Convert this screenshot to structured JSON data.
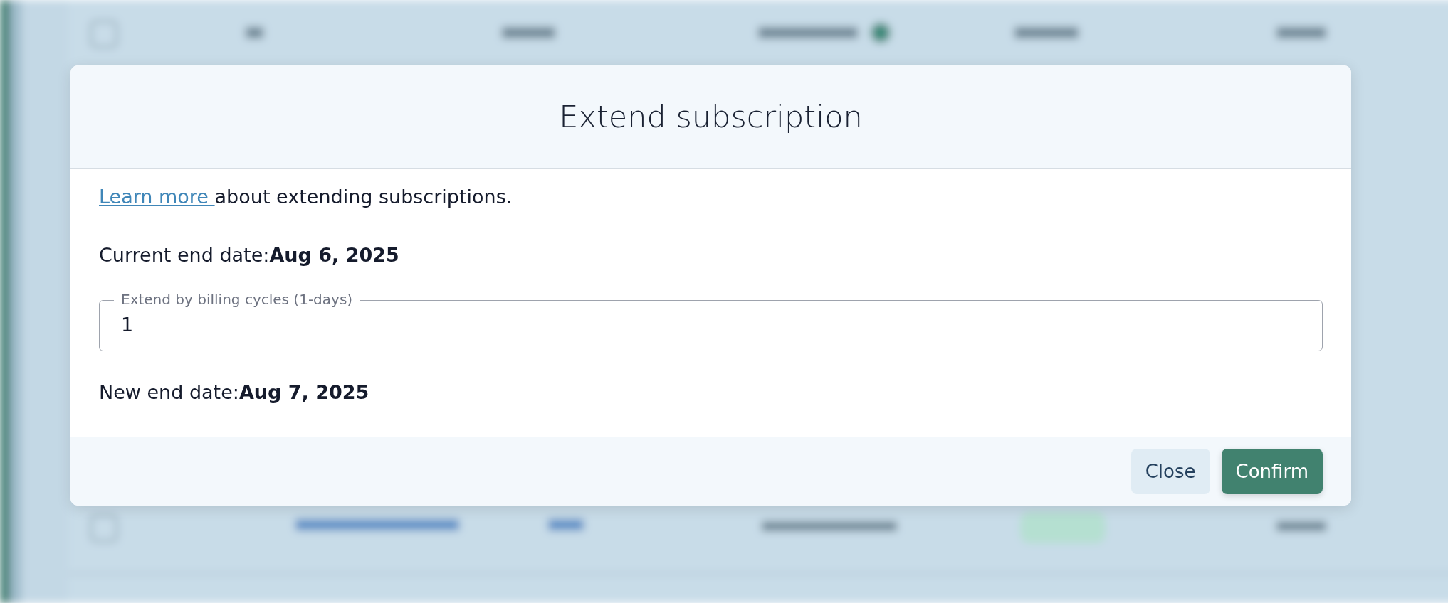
{
  "dialog": {
    "title": "Extend subscription",
    "intro": {
      "link": "Learn more ",
      "text": "about extending subscriptions."
    },
    "current_end": {
      "label": "Current end date:",
      "value": "Aug 6, 2025"
    },
    "field": {
      "label": "Extend by billing cycles (1-days)",
      "value": "1"
    },
    "new_end": {
      "label": "New end date:",
      "value": "Aug 7, 2025"
    },
    "buttons": [
      {
        "label": "Close",
        "kind": "secondary"
      },
      {
        "label": "Confirm",
        "kind": "primary"
      }
    ]
  }
}
